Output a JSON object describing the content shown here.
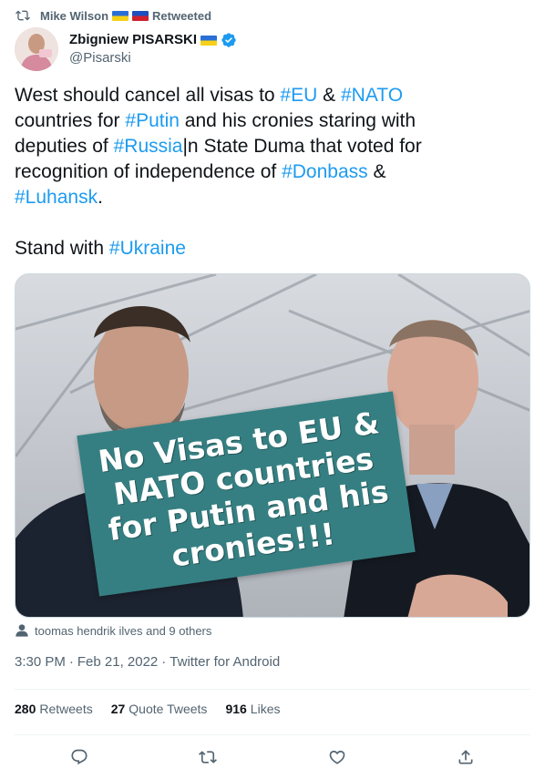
{
  "retweet": {
    "retweeter": "Mike Wilson",
    "label": "Retweeted",
    "icon": "retweet-icon"
  },
  "author": {
    "display_name": "Zbigniew PISARSKI",
    "handle": "@Pisarski",
    "verified": true,
    "avatar_icon": "avatar"
  },
  "tweet": {
    "seg": [
      "West should cancel all visas to ",
      "#EU",
      " & ",
      "#NATO",
      "\ncountries for ",
      "#Putin",
      " and his cronies staring with\ndeputies of ",
      "#Russia",
      "|n State Duma that voted for\nrecognition of independence of ",
      "#Donbass",
      " &\n",
      "#Luhansk",
      ".\n\nStand with ",
      "#Ukraine"
    ]
  },
  "media": {
    "overlay_text": "No Visas to EU &\nNATO countries\nfor Putin and his\ncronies!!!"
  },
  "tagged": {
    "text": "toomas hendrik ilves and 9 others",
    "icon": "person-icon"
  },
  "meta": {
    "time": "3:30 PM",
    "date": "Feb 21, 2022",
    "source": "Twitter for Android",
    "dot": "·"
  },
  "stats": {
    "retweets_count": "280",
    "retweets_label": "Retweets",
    "quotes_count": "27",
    "quotes_label": "Quote Tweets",
    "likes_count": "916",
    "likes_label": "Likes"
  },
  "actions": [
    "reply-icon",
    "retweet-icon",
    "like-icon",
    "share-icon"
  ],
  "colors": {
    "link": "#1d9bf0",
    "secondary": "#536471",
    "overlay": "#357f82"
  }
}
